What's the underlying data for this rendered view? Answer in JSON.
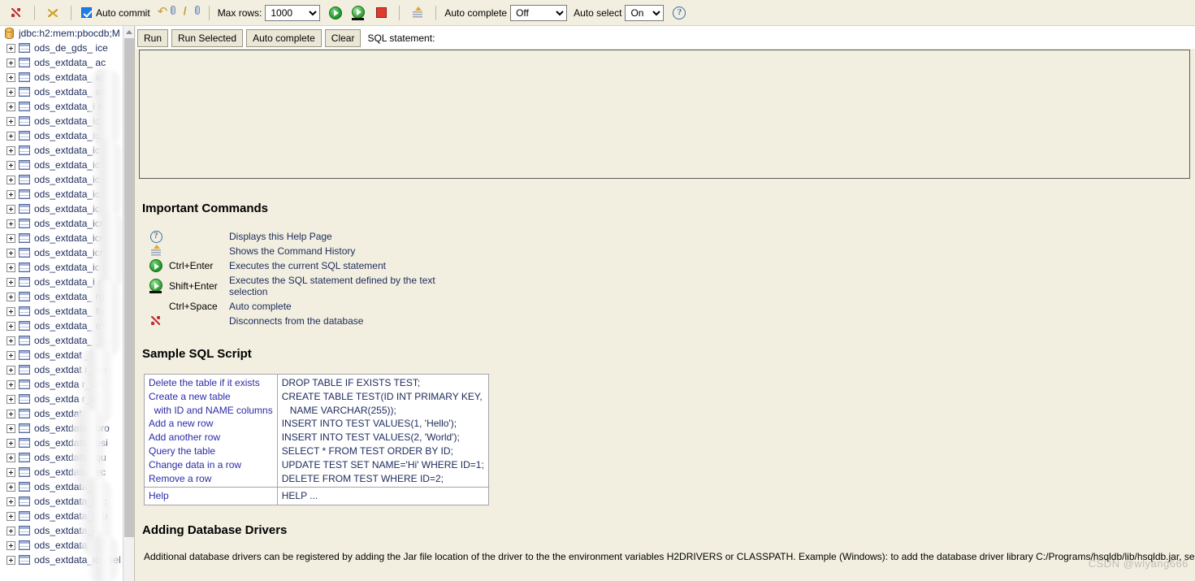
{
  "toolbar": {
    "disconnect_icon": "disconnect-icon",
    "connect_icon": "connect-icon",
    "auto_commit_label": "Auto commit",
    "auto_commit_checked": true,
    "commit_icon": "commit-icon",
    "rollback_icon": "rollback-icon",
    "max_rows_label": "Max rows:",
    "max_rows_value": "1000",
    "max_rows_options": [
      "1000"
    ],
    "run_icon": "run-icon",
    "run_selected_icon": "run-selected-icon",
    "stop_icon": "stop-icon",
    "history_icon": "history-icon",
    "auto_complete_label": "Auto complete",
    "auto_complete_value": "Off",
    "auto_complete_options": [
      "Off"
    ],
    "auto_select_label": "Auto select",
    "auto_select_value": "On",
    "auto_select_options": [
      "On"
    ],
    "help_icon": "help-icon"
  },
  "commands": {
    "run_label": "Run",
    "run_selected_label": "Run Selected",
    "auto_complete_label": "Auto complete",
    "clear_label": "Clear",
    "sql_statement_label": "SQL statement:",
    "sql_textarea_value": "",
    "sql_textarea_placeholder": ""
  },
  "tree": {
    "root_label": "jdbc:h2:mem:pbocdb;M",
    "items": [
      "ods_de_gds_        ice",
      "ods_extdata_        ac",
      "ods_extdata_        ad",
      "ods_extdata_         ad",
      "ods_extdata_i        a",
      "ods_extdata_ic        /",
      "ods_extdata_ic",
      "ods_extdata_ic",
      "ods_extdata_ic",
      "ods_extdata_ic",
      "ods_extdata_ic",
      "ods_extdata_ic",
      "ods_extdata_icr",
      "ods_extdata_icr",
      "ods_extdata_icr",
      "ods_extdata_ic        :",
      "ods_extdata_i        a",
      "ods_extdata_        rg",
      "ods_extdata_        ltst",
      "ods_extdata_        me",
      "ods_extdata_      _no",
      "ods_extdat        _no",
      "ods_extdat      r_oth",
      "ods_extda      r_oth",
      "ods_extda        r_ov",
      "ods_extdat        _ph",
      "ods_extdata       _pro",
      "ods_extdata_      psi",
      "ods_extdata_       qu",
      "ods_extdata_       ec",
      "ods_extdata_i       o",
      "ods_extdata_ic       c",
      "ods_extdata_ic       p",
      "ods_extdata_i       s",
      "ods_extdata_i       o",
      "ods_extdata_icr_sel"
    ]
  },
  "important_commands": {
    "title": "Important Commands",
    "rows": [
      {
        "icon": "help-icon",
        "key": "",
        "description": "Displays this Help Page"
      },
      {
        "icon": "history-icon",
        "key": "",
        "description": "Shows the Command History"
      },
      {
        "icon": "run-icon",
        "key": "Ctrl+Enter",
        "description": "Executes the current SQL statement"
      },
      {
        "icon": "run-selected-icon",
        "key": "Shift+Enter",
        "description": "Executes the SQL statement defined by the text selection"
      },
      {
        "icon": "",
        "key": "Ctrl+Space",
        "description": "Auto complete"
      },
      {
        "icon": "disconnect-icon",
        "key": "",
        "description": "Disconnects from the database"
      }
    ]
  },
  "sample_sql": {
    "title": "Sample SQL Script",
    "rows": [
      {
        "description": "Delete the table if it exists",
        "sql": "DROP TABLE IF EXISTS TEST;"
      },
      {
        "description": "Create a new table\n  with ID and NAME columns",
        "sql": "CREATE TABLE TEST(ID INT PRIMARY KEY,\n   NAME VARCHAR(255));"
      },
      {
        "description": "Add a new row",
        "sql": "INSERT INTO TEST VALUES(1, 'Hello');"
      },
      {
        "description": "Add another row",
        "sql": "INSERT INTO TEST VALUES(2, 'World');"
      },
      {
        "description": "Query the table",
        "sql": "SELECT * FROM TEST ORDER BY ID;"
      },
      {
        "description": "Change data in a row",
        "sql": "UPDATE TEST SET NAME='Hi' WHERE ID=1;"
      },
      {
        "description": "Remove a row",
        "sql": "DELETE FROM TEST WHERE ID=2;"
      }
    ],
    "help_row": {
      "description": "Help",
      "sql": "HELP ..."
    }
  },
  "drivers": {
    "title": "Adding Database Drivers",
    "text": "Additional database drivers can be registered by adding the Jar file location of the driver to the the environment variables H2DRIVERS or CLASSPATH. Example (Windows): to add the database driver library C:/Programs/hsqldb/lib/hsqldb.jar, se"
  },
  "watermark": {
    "text": "CSDN @wlyang666"
  },
  "colors": {
    "page_background": "#f2efe0",
    "tree_background": "#ffffff",
    "link_text": "#2b2ba8",
    "body_text": "#1c2a5a",
    "accent_checkbox": "#1e7ce8",
    "stop_red": "#e03a2f",
    "run_green": "#1f8f2a"
  }
}
